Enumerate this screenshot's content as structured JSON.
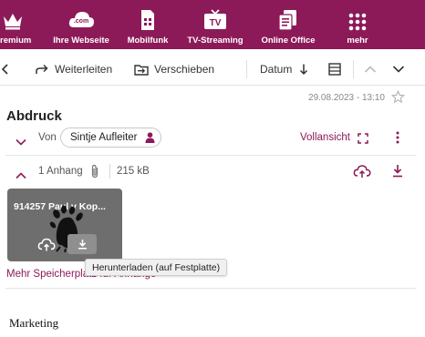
{
  "nav": {
    "items": [
      {
        "label": "Premium",
        "icon": "crown-icon"
      },
      {
        "label": "Ihre Webseite",
        "icon": "com-cloud-icon"
      },
      {
        "label": "Mobilfunk",
        "icon": "sim-card-icon"
      },
      {
        "label": "TV-Streaming",
        "icon": "tv-icon"
      },
      {
        "label": "Online Office",
        "icon": "office-icon"
      },
      {
        "label": "mehr",
        "icon": "grid-icon"
      }
    ],
    "com_text": ".com",
    "tv_text": "TV"
  },
  "toolbar": {
    "forward": "Weiterleiten",
    "move": "Verschieben",
    "sort": "Datum"
  },
  "message": {
    "date": "29.08.2023 - 13:10",
    "subject": "Abdruck",
    "from_label": "Von",
    "sender": "Sintje Aufleiter",
    "full_view": "Vollansicht"
  },
  "attachments": {
    "count": "1 Anhang",
    "size": "215 kB",
    "file_name": "914257 Paul v Kop...",
    "tooltip": "Herunterladen (auf Festplatte)",
    "more_storage": "Mehr Speicherplatz für Anhänge"
  },
  "body": {
    "text": "Marketing"
  },
  "colors": {
    "brand": "#8c1a58",
    "tile": "#6e6e6e"
  }
}
